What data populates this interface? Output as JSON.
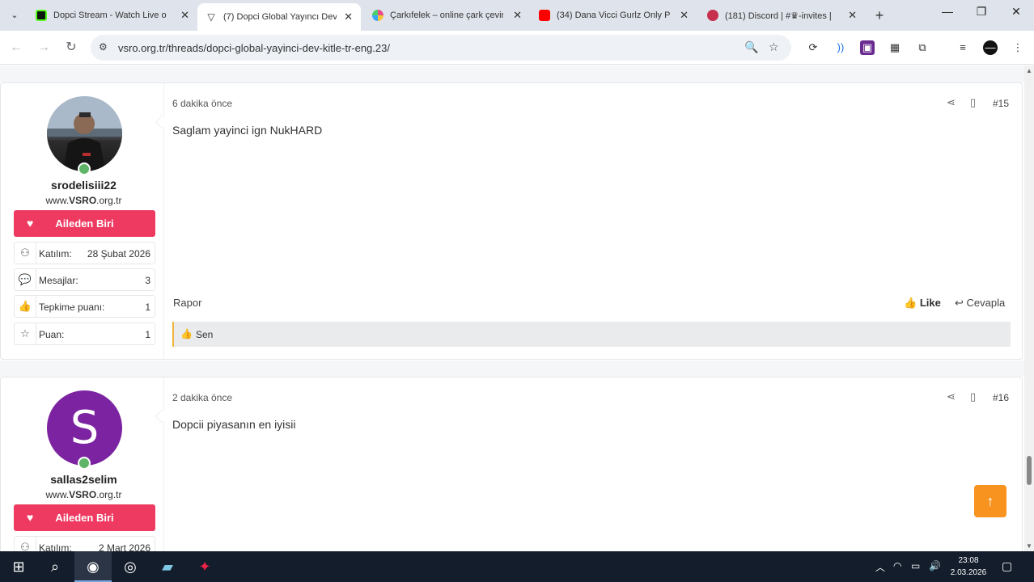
{
  "browser": {
    "tabs": [
      {
        "title": "Dopci Stream - Watch Live o",
        "fav_color": "#53fc18"
      },
      {
        "title": "(7) Dopci Global Yayıncı Dev",
        "fav_color": "#2b2b2b"
      },
      {
        "title": "Çarkıfelek – online çark çevir",
        "fav_color": "#e84b8a"
      },
      {
        "title": "(34) Dana Vicci Gurlz Only P",
        "fav_color": "#ff0000"
      },
      {
        "title": "(181) Discord | #♛-invites |",
        "fav_color": "#c6304d"
      }
    ],
    "url": "vsro.org.tr/threads/dopci-global-yayinci-dev-kitle-tr-eng.23/"
  },
  "posts": [
    {
      "username": "srodelisiii22",
      "user_title_prefix": "www.",
      "user_title_bold": "VSRO",
      "user_title_suffix": ".org.tr",
      "badge": "Aileden Biri",
      "stats": [
        {
          "key": "Katılım:",
          "value": "28 Şubat 2026"
        },
        {
          "key": "Mesajlar:",
          "value": "3"
        },
        {
          "key": "Tepkime puanı:",
          "value": "1"
        },
        {
          "key": "Puan:",
          "value": "1"
        }
      ],
      "date": "6 dakika önce",
      "post_number": "#15",
      "body": "Saglam yayinci ign NukHARD",
      "report": "Rapor",
      "like": "Like",
      "reply": "Cevapla",
      "reaction_by": "Sen"
    },
    {
      "username": "sallas2selim",
      "avatar_letter": "S",
      "user_title_prefix": "www.",
      "user_title_bold": "VSRO",
      "user_title_suffix": ".org.tr",
      "badge": "Aileden Biri",
      "stats": [
        {
          "key": "Katılım:",
          "value": "2 Mart 2026"
        }
      ],
      "date": "2 dakika önce",
      "post_number": "#16",
      "body": "Dopcii piyasanın en iyisii"
    }
  ],
  "taskbar": {
    "time": "23:08",
    "date": "2.03.2026"
  }
}
